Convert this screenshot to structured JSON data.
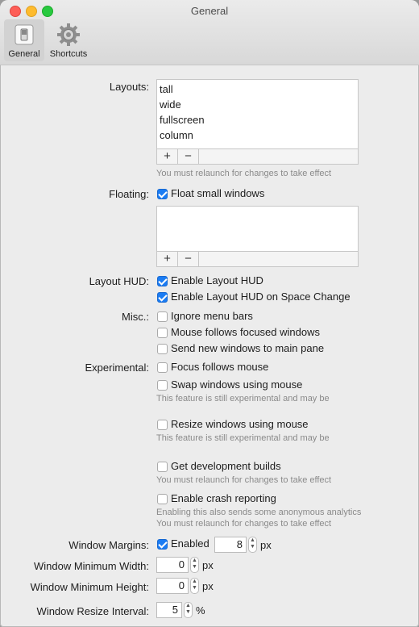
{
  "window": {
    "title": "General"
  },
  "toolbar": {
    "general": "General",
    "shortcuts": "Shortcuts"
  },
  "layouts": {
    "label": "Layouts:",
    "items": [
      "tall",
      "wide",
      "fullscreen",
      "column"
    ],
    "add": "+",
    "remove": "−",
    "note": "You must relaunch for changes to take effect"
  },
  "floating": {
    "label": "Floating:",
    "checkbox": "Float small windows",
    "add": "+",
    "remove": "−"
  },
  "hud": {
    "label": "Layout HUD:",
    "enable": "Enable Layout HUD",
    "space_change": "Enable Layout HUD on Space Change"
  },
  "misc": {
    "label": "Misc.:",
    "ignore_menu_bars": "Ignore menu bars",
    "mouse_follows": "Mouse follows focused windows",
    "send_new": "Send new windows to main pane"
  },
  "experimental": {
    "label": "Experimental:",
    "focus_follows": "Focus follows mouse",
    "swap": "Swap windows using mouse",
    "swap_note": "This feature is still experimental and may be",
    "resize": "Resize windows using mouse",
    "resize_note": "This feature is still experimental and may be",
    "dev_builds": "Get development builds",
    "dev_note": "You must relaunch for changes to take effect",
    "crash": "Enable crash reporting",
    "crash_note1": "Enabling this also sends some anonymous analytics",
    "crash_note2": "You must relaunch for changes to take effect"
  },
  "margins": {
    "label": "Window Margins:",
    "enabled": "Enabled",
    "value": "8",
    "unit": "px"
  },
  "min_width": {
    "label": "Window Minimum Width:",
    "value": "0",
    "unit": "px"
  },
  "min_height": {
    "label": "Window Minimum Height:",
    "value": "0",
    "unit": "px"
  },
  "resize_interval": {
    "label": "Window Resize Interval:",
    "value": "5",
    "unit": "%"
  },
  "colors": {
    "accent": "#1b7cf3",
    "background": "#ececec"
  }
}
